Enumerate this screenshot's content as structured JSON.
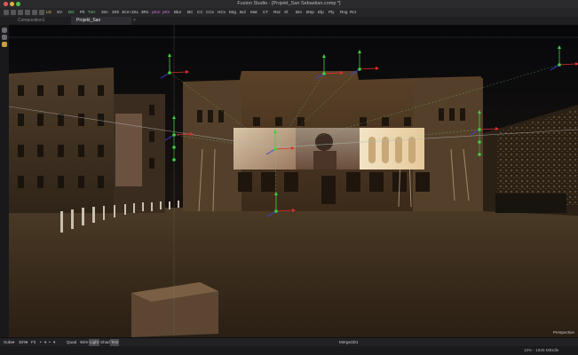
{
  "window": {
    "title": "Fusion Studio - [Projekt_San Sebastian.comp *]"
  },
  "toolbar": {
    "items": [
      {
        "label": "LD",
        "color": "#e0d050"
      },
      {
        "label": "SV",
        "color": "#d0d0d0"
      },
      {
        "label": "BG",
        "color": "#6fd06f"
      },
      {
        "label": "Pit",
        "color": "#d0d0d0"
      },
      {
        "label": "Txt+",
        "color": "#6fd06f"
      },
      {
        "label": "3Im",
        "color": "#d0d0d0"
      },
      {
        "label": "3Sh",
        "color": "#d0d0d0"
      },
      {
        "label": "3Cm",
        "color": "#d0d0d0"
      },
      {
        "label": "3SL",
        "color": "#d0d0d0"
      },
      {
        "label": "3Rn",
        "color": "#d0d0d0"
      },
      {
        "label": "pEm",
        "color": "#d070d0"
      },
      {
        "label": "pRn",
        "color": "#d070d0"
      },
      {
        "label": "Blur",
        "color": "#d0d0d0"
      },
      {
        "label": "BC",
        "color": "#d0d0d0"
      },
      {
        "label": "CC",
        "color": "#d0d0d0"
      },
      {
        "label": "CCv",
        "color": "#d0d0d0"
      },
      {
        "label": "HCv",
        "color": "#d0d0d0"
      },
      {
        "label": "Mrg",
        "color": "#d0d0d0"
      },
      {
        "label": "Bol",
        "color": "#d0d0d0"
      },
      {
        "label": "Mat",
        "color": "#d0d0d0"
      },
      {
        "label": "CT",
        "color": "#d0d0d0"
      },
      {
        "label": "Rsz",
        "color": "#d0d0d0"
      },
      {
        "label": "Xf",
        "color": "#d0d0d0"
      },
      {
        "label": "Bm",
        "color": "#d0d0d0"
      },
      {
        "label": "BSp",
        "color": "#d0d0d0"
      },
      {
        "label": "Elp",
        "color": "#d0d0d0"
      },
      {
        "label": "Ply",
        "color": "#d0d0d0"
      },
      {
        "label": "Rng",
        "color": "#d0d0d0"
      },
      {
        "label": "Rct",
        "color": "#d0d0d0"
      }
    ]
  },
  "tabs": [
    {
      "label": "Composition1",
      "active": false
    },
    {
      "label": "Projekt_San Sebastian.comp *",
      "active": true
    }
  ],
  "viewer": {
    "subview": "Subv",
    "zoom": "30%",
    "fit": "Fit",
    "quad": "Quad",
    "wire": "Wire",
    "light": "Light",
    "shad": "Shad",
    "text": "Text",
    "node_name": "Merge3D1",
    "camera": "Perspective"
  },
  "status": {
    "memory": "10% - 1836 MB",
    "state": "Idle"
  },
  "colors": {
    "accent_green": "#3fcf3f",
    "accent_red": "#e03030",
    "gizmo_blue": "#4040e0"
  }
}
